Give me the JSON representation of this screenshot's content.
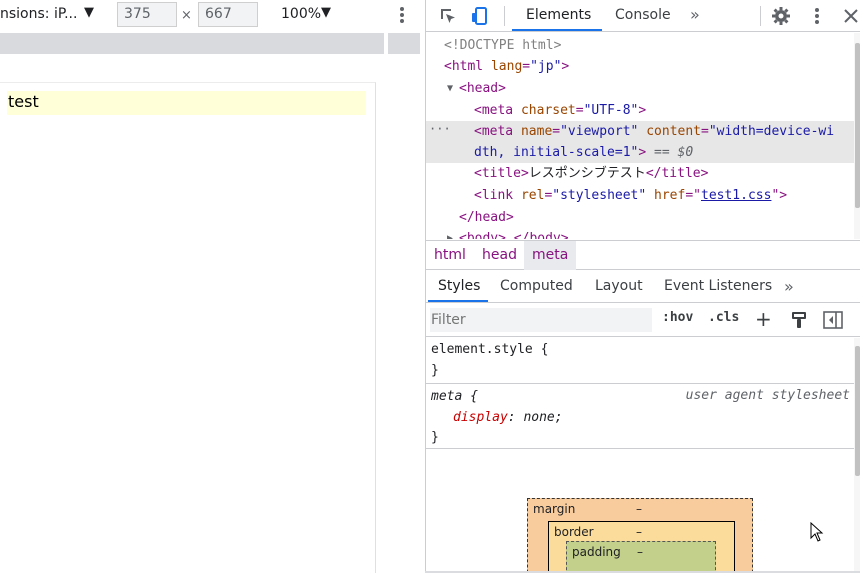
{
  "device_toolbar": {
    "dimensions_label": "nsions: iP...",
    "dropdown_arrow": "▼",
    "width": "375",
    "height": "667",
    "separator": "×",
    "zoom": "100%",
    "zoom_arrow": "▼"
  },
  "page": {
    "content_text": "test"
  },
  "devtools": {
    "tabs": [
      {
        "label": "Elements",
        "active": true
      },
      {
        "label": "Console",
        "active": false
      }
    ],
    "more_tabs": "»",
    "dom": {
      "doctype": "<!DOCTYPE html>",
      "html_open": "<html",
      "html_attr": "lang",
      "html_attr_val": "\"jp\"",
      "head_open": "<head>",
      "meta1_tag": "<meta",
      "meta1_attr": "charset",
      "meta1_val": "\"UTF-8\"",
      "meta2_tag": "<meta",
      "meta2_attr1": "name",
      "meta2_val1": "\"viewport\"",
      "meta2_attr2": "content",
      "meta2_val2a": "\"width=device-wi",
      "meta2_val2b": "dth, initial-scale=1\"",
      "meta2_close": ">",
      "selected_marker": "== $0",
      "title_open": "<title>",
      "title_text": "レスポンシブテスト",
      "title_close": "</title>",
      "link_tag": "<link",
      "link_attr1": "rel",
      "link_val1": "\"stylesheet\"",
      "link_attr2": "href",
      "link_val2": "test1.css",
      "head_close": "</head>",
      "body_partial": "<body>",
      "body_close_partial": "</body>",
      "ellipsis": "···"
    },
    "breadcrumb": [
      "html",
      "head",
      "meta"
    ],
    "styles_tabs": [
      {
        "label": "Styles",
        "active": true
      },
      {
        "label": "Computed",
        "active": false
      },
      {
        "label": "Layout",
        "active": false
      },
      {
        "label": "Event Listeners",
        "active": false
      }
    ],
    "styles_more": "»",
    "filter_placeholder": "Filter",
    "hov_label": ":hov",
    "cls_label": ".cls",
    "add_rule": "+",
    "rules": {
      "element_selector": "element.style {",
      "element_close": "}",
      "meta_selector": "meta {",
      "meta_source": "user agent stylesheet",
      "meta_prop": "display",
      "meta_val": "none;",
      "meta_close": "}"
    },
    "box_model": {
      "margin_label": "margin",
      "margin_value": "–",
      "border_label": "border",
      "border_value": "–",
      "padding_label": "padding",
      "padding_value": "–"
    }
  },
  "colors": {
    "accent": "#1a73e8",
    "tag": "#881280",
    "attribute": "#994500",
    "attribute_value": "#1a1aa6",
    "highlight": "#ffffd8",
    "box_margin": "#f9cc9d",
    "box_border": "#fcdc9b",
    "box_padding": "#c3d08b"
  }
}
